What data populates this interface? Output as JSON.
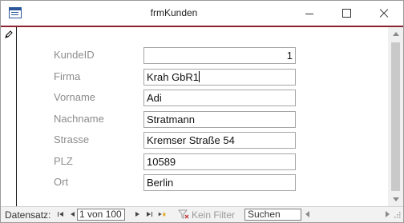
{
  "window": {
    "title": "frmKunden"
  },
  "form": {
    "fields": [
      {
        "label": "KundeID",
        "value": "1"
      },
      {
        "label": "Firma",
        "value": "Krah GbR1"
      },
      {
        "label": "Vorname",
        "value": "Adi"
      },
      {
        "label": "Nachname",
        "value": "Stratmann"
      },
      {
        "label": "Strasse",
        "value": "Kremser Straße 54"
      },
      {
        "label": "PLZ",
        "value": "10589"
      },
      {
        "label": "Ort",
        "value": "Berlin"
      }
    ]
  },
  "navigation": {
    "label": "Datensatz:",
    "current": "1 von 100",
    "filter_label": "Kein Filter",
    "search_placeholder": "Suchen"
  },
  "colors": {
    "accent": "#8a2433",
    "label_text": "#8c8c8c"
  }
}
